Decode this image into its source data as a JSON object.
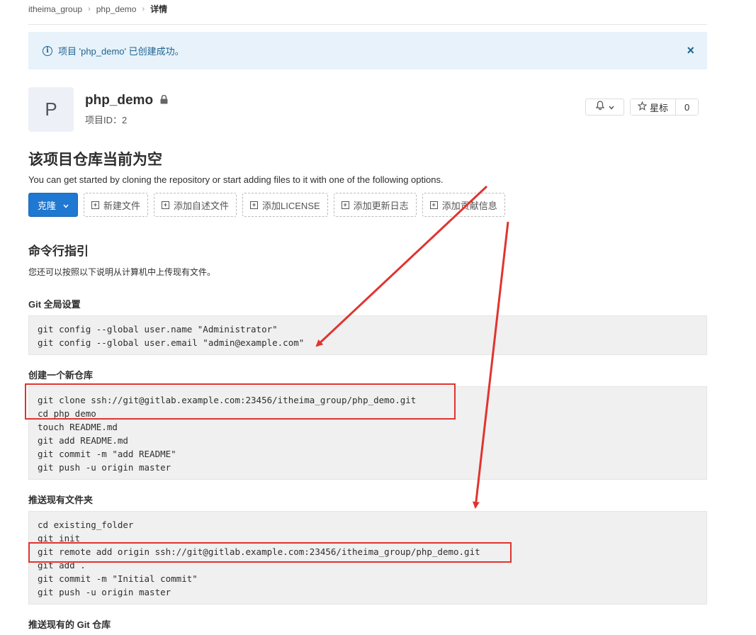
{
  "breadcrumb": {
    "group": "itheima_group",
    "project": "php_demo",
    "current": "详情"
  },
  "flash": {
    "message": "项目 'php_demo' 已创建成功。",
    "close": "×"
  },
  "project": {
    "avatar_letter": "P",
    "name": "php_demo",
    "id_label": "项目ID：2"
  },
  "actions": {
    "star_label": "星标",
    "star_count": "0"
  },
  "empty": {
    "title": "该项目仓库当前为空",
    "description": "You can get started by cloning the repository or start adding files to it with one of the following options."
  },
  "buttons": {
    "clone": "克隆",
    "new_file": "新建文件",
    "add_readme": "添加自述文件",
    "add_license": "添加LICENSE",
    "add_changelog": "添加更新日志",
    "add_contributing": "添加贡献信息"
  },
  "instructions": {
    "title": "命令行指引",
    "intro": "您还可以按照以下说明从计算机中上传现有文件。",
    "global_setup": {
      "heading": "Git 全局设置",
      "lines": [
        "git config --global user.name \"Administrator\"",
        "git config --global user.email \"admin@example.com\""
      ]
    },
    "new_repo": {
      "heading": "创建一个新仓库",
      "lines": [
        "git clone ssh://git@gitlab.example.com:23456/itheima_group/php_demo.git",
        "cd php_demo",
        "touch README.md",
        "git add README.md",
        "git commit -m \"add README\"",
        "git push -u origin master"
      ]
    },
    "existing_folder": {
      "heading": "推送现有文件夹",
      "lines": [
        "cd existing_folder",
        "git init",
        "git remote add origin ssh://git@gitlab.example.com:23456/itheima_group/php_demo.git",
        "git add .",
        "git commit -m \"Initial commit\"",
        "git push -u origin master"
      ]
    },
    "existing_repo": {
      "heading": "推送现有的 Git 仓库"
    }
  },
  "colors": {
    "primary": "#1f78d1",
    "annotation": "#e0342f",
    "flash_bg": "#e7f2fa"
  },
  "icons": [
    "info-icon",
    "close-icon",
    "lock-icon",
    "bell-icon",
    "chevron-down-icon",
    "star-icon",
    "plus-square-icon"
  ]
}
